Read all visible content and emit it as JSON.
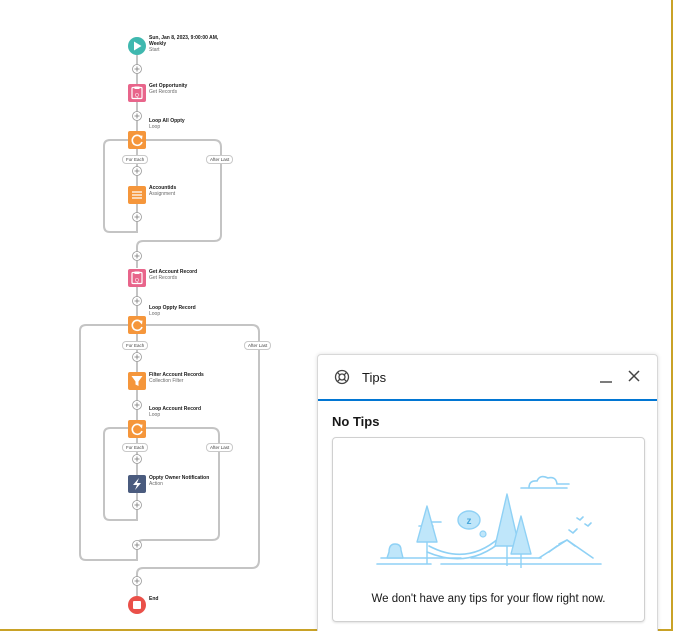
{
  "flow": {
    "start": {
      "title_line1": "Sun, Jan 8, 2023, 9:00:00 AM,",
      "title_line2": "Weekly",
      "subtitle": "Start"
    },
    "get_opportunity": {
      "title": "Get Opportunity",
      "subtitle": "Get Records"
    },
    "loop_all_oppty": {
      "title": "Loop All Oppty",
      "subtitle": "Loop"
    },
    "accountids": {
      "title": "Accountids",
      "subtitle": "Assignment"
    },
    "get_account_record": {
      "title": "Get Account Record",
      "subtitle": "Get Records"
    },
    "loop_oppty_record": {
      "title": "Loop Oppty Record",
      "subtitle": "Loop"
    },
    "filter_account_records": {
      "title": "Filter Account Records",
      "subtitle": "Collection Filter"
    },
    "loop_account_record": {
      "title": "Loop Account Record",
      "subtitle": "Loop"
    },
    "oppty_owner_notification": {
      "title": "Oppty Owner Notification",
      "subtitle": "Action"
    },
    "end": {
      "title": "End"
    },
    "pills": {
      "for_each": "For Each",
      "after_last": "After Last"
    }
  },
  "colors": {
    "start": "#3fb8af",
    "get_records": "#e8658b",
    "loop": "#f5963b",
    "assignment": "#f5963b",
    "filter": "#f5963b",
    "action": "#4a5b7e",
    "end": "#ea5049",
    "connector": "#c4c4c4",
    "accent": "#0176d3"
  },
  "tips": {
    "title": "Tips",
    "heading": "No Tips",
    "empty_message": "We don't have any tips for your flow right now."
  }
}
